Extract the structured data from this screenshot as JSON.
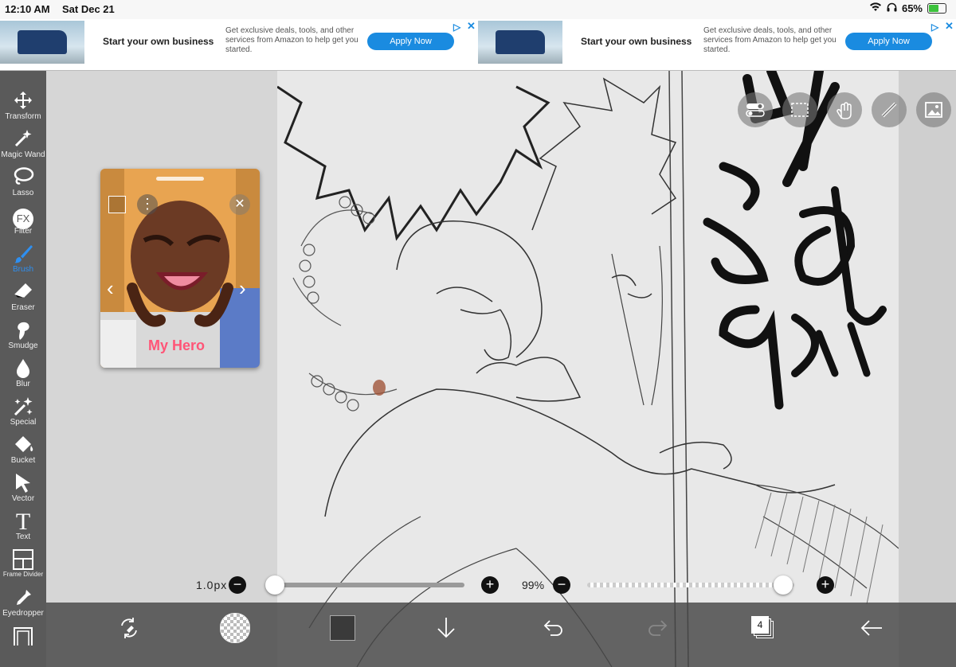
{
  "status": {
    "time": "12:10 AM",
    "date": "Sat Dec 21",
    "battery_pct": "65%",
    "battery_level": 0.65
  },
  "ads": [
    {
      "headline": "Start your own business",
      "body": "Get exclusive deals, tools, and other services from Amazon to help get you started.",
      "cta": "Apply Now"
    },
    {
      "headline": "Start your own business",
      "body": "Get exclusive deals, tools, and other services from Amazon to help get you started.",
      "cta": "Apply Now"
    }
  ],
  "tools": [
    {
      "label": "Transform",
      "icon": "move-arrows-icon"
    },
    {
      "label": "Magic Wand",
      "icon": "magic-wand-icon"
    },
    {
      "label": "Lasso",
      "icon": "lasso-icon"
    },
    {
      "label": "Filter",
      "icon": "fx-icon",
      "glyph": "FX"
    },
    {
      "label": "Brush",
      "icon": "brush-icon"
    },
    {
      "label": "Eraser",
      "icon": "eraser-icon"
    },
    {
      "label": "Smudge",
      "icon": "smudge-icon"
    },
    {
      "label": "Blur",
      "icon": "drop-icon"
    },
    {
      "label": "Special",
      "icon": "sparkle-icon"
    },
    {
      "label": "Bucket",
      "icon": "bucket-icon"
    },
    {
      "label": "Vector",
      "icon": "cursor-arrow-icon"
    },
    {
      "label": "Text",
      "icon": "text-icon",
      "glyph": "T"
    },
    {
      "label": "Frame Divider",
      "icon": "frame-divider-icon"
    },
    {
      "label": "Eyedropper",
      "icon": "eyedropper-icon"
    }
  ],
  "active_tool": "Brush",
  "brush": {
    "size_label": "1.0px",
    "size_level": 0.0,
    "opacity_label": "99%",
    "opacity_level": 0.99
  },
  "layers": {
    "count": "4"
  },
  "colors": {
    "accent": "#2e8ff0",
    "toolbar": "#5a5a5a",
    "current_color": "#3a3a3a"
  }
}
